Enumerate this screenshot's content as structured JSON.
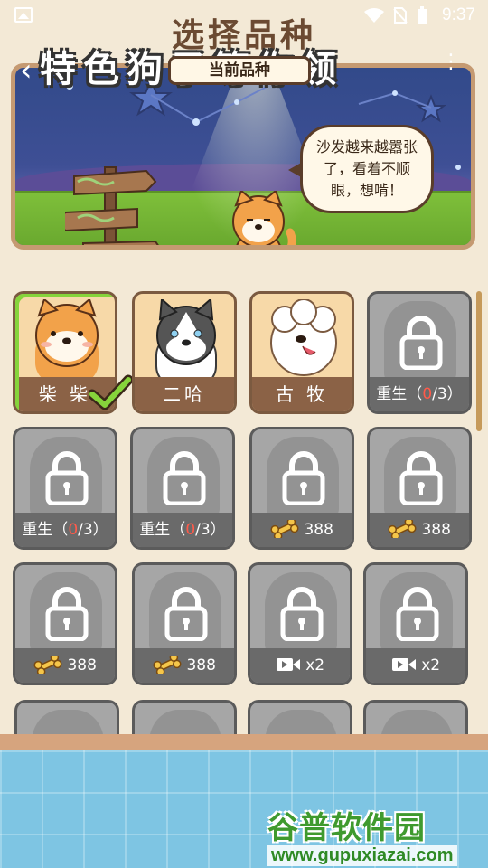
{
  "status_bar": {
    "time": "9:37"
  },
  "header": {
    "title": "选择品种"
  },
  "banner": {
    "label": "当前品种",
    "speech": "沙发越来越嚣张了，看着不顺眼，想啃！"
  },
  "breeds": [
    {
      "label": "柴 柴",
      "state": "unlocked",
      "selected": true
    },
    {
      "label": "二哈",
      "state": "unlocked",
      "selected": false
    },
    {
      "label": "古 牧",
      "state": "unlocked",
      "selected": false
    },
    {
      "label_prefix": "重生（",
      "label_red": "0",
      "label_suffix": "/3）",
      "state": "locked"
    },
    {
      "label_prefix": "重生（",
      "label_red": "0",
      "label_suffix": "/3）",
      "state": "locked"
    },
    {
      "label_prefix": "重生（",
      "label_red": "0",
      "label_suffix": "/3）",
      "state": "locked"
    },
    {
      "cost": "388",
      "icon": "bone-icon",
      "state": "locked"
    },
    {
      "cost": "388",
      "icon": "bone-icon",
      "state": "locked"
    },
    {
      "cost": "388",
      "icon": "bone-icon",
      "state": "locked"
    },
    {
      "cost": "388",
      "icon": "bone-icon",
      "state": "locked"
    },
    {
      "cost": "x2",
      "icon": "video-icon",
      "state": "locked"
    },
    {
      "cost": "x2",
      "icon": "video-icon",
      "state": "locked"
    }
  ],
  "bottom_banner": {
    "text": "特色狗子等你领"
  },
  "watermark": {
    "name": "谷普软件园",
    "url": "www.gupuxiazai.com"
  },
  "colors": {
    "selected_border": "#86d43b",
    "locked_card": "#a6a6a6",
    "title": "#6b4a32"
  }
}
